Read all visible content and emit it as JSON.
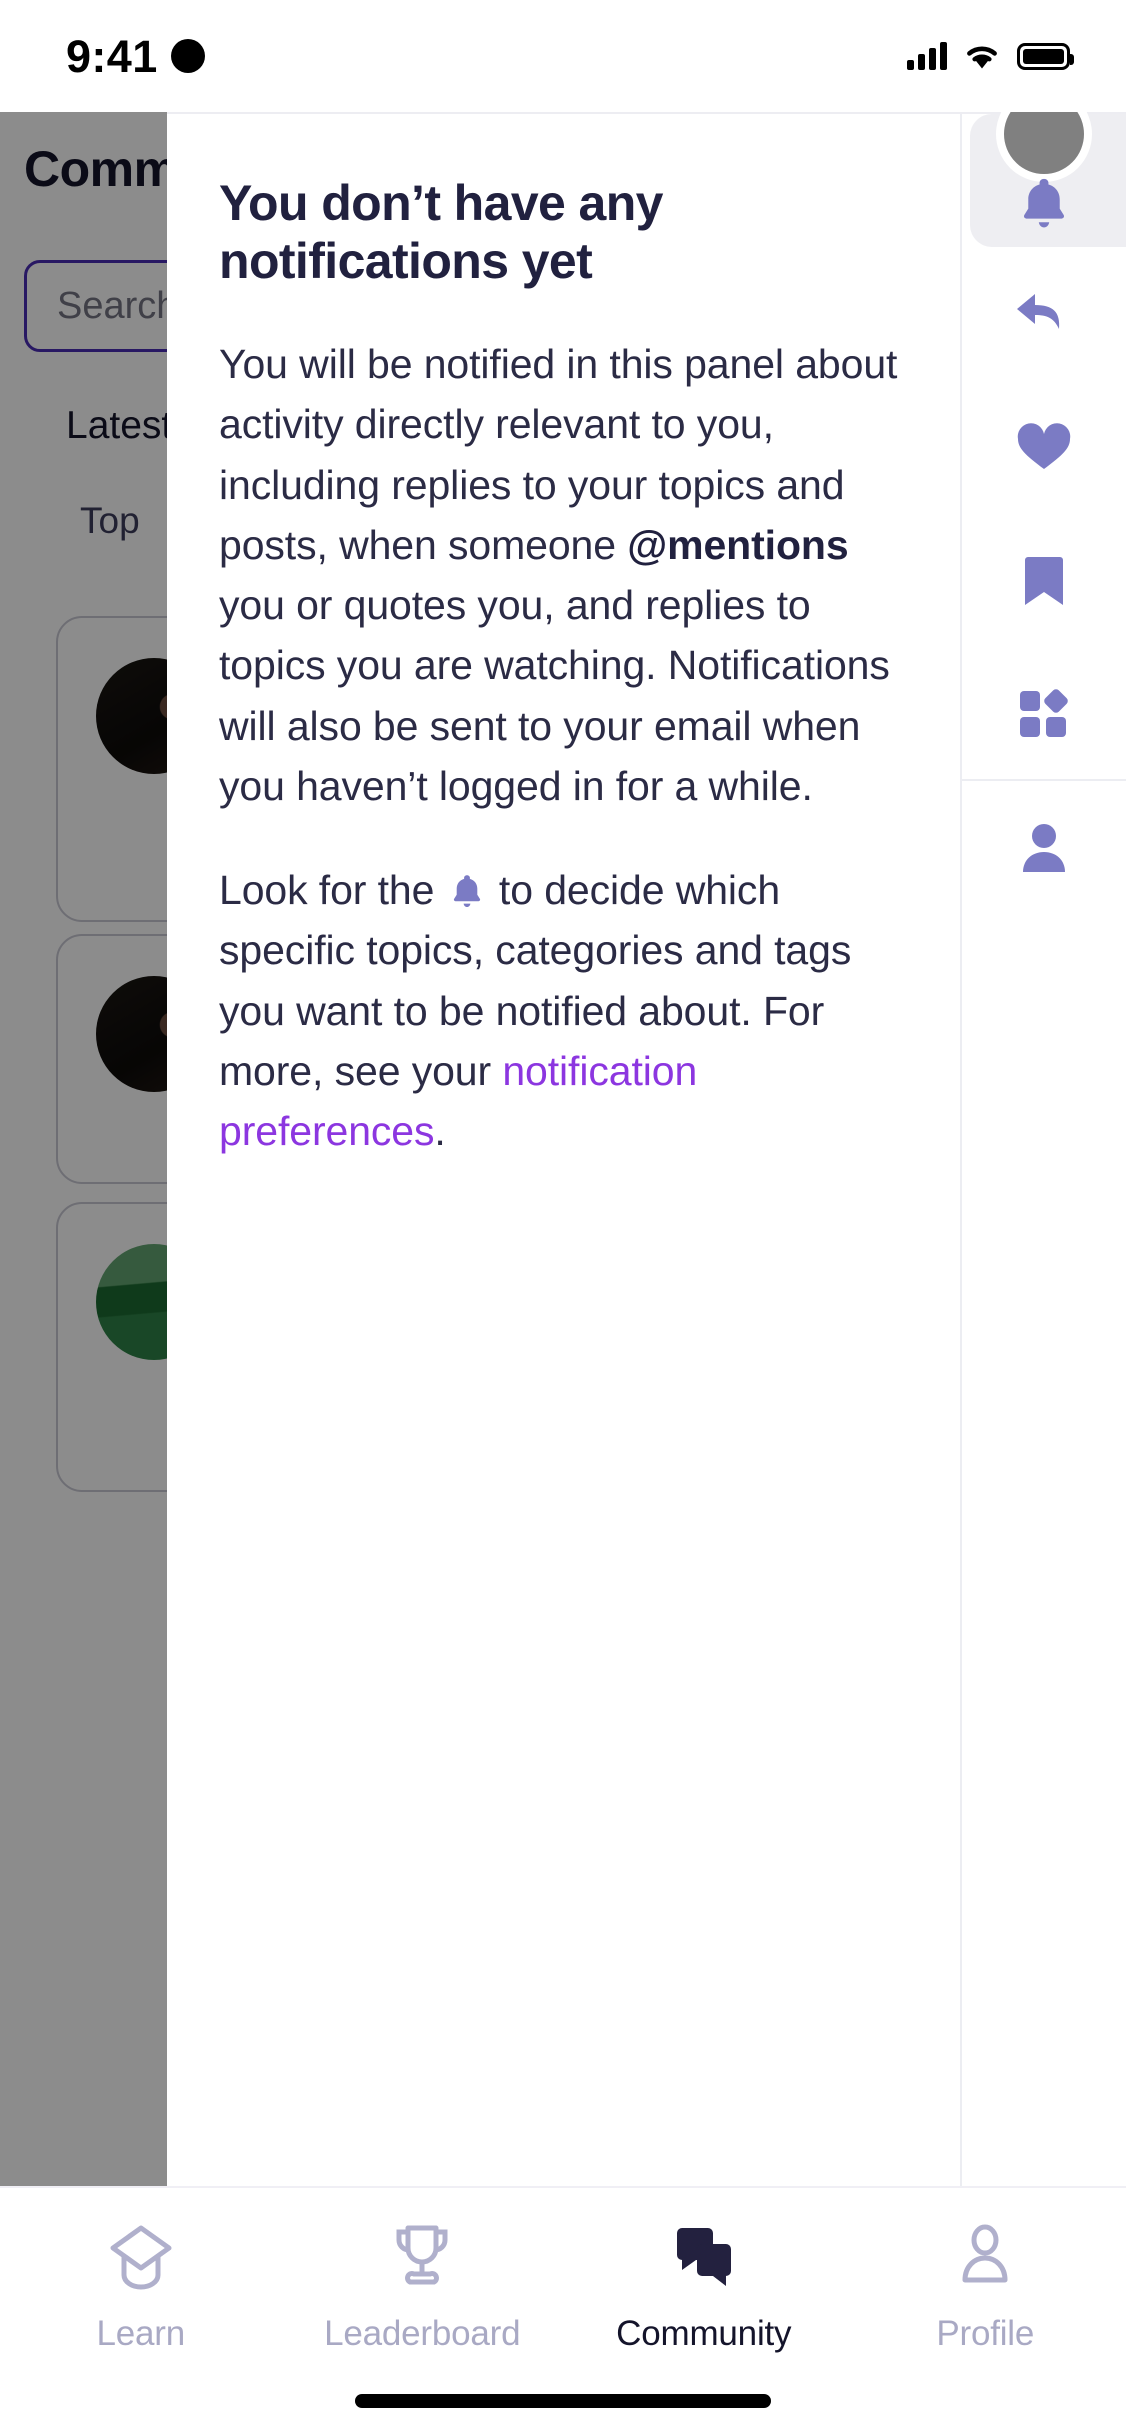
{
  "status_bar": {
    "time": "9:41",
    "icons": [
      "moon-icon",
      "cellular-signal-icon",
      "wifi-icon",
      "battery-icon"
    ]
  },
  "background_app": {
    "title": "Community",
    "search": {
      "placeholder": "Search",
      "value": ""
    },
    "segments": [
      {
        "label": "Latest",
        "active": true
      },
      {
        "label": "Top",
        "active": false
      }
    ],
    "cards": [
      {
        "avatar": "dark-portrait-avatar"
      },
      {
        "avatar": "dark-portrait-avatar"
      },
      {
        "avatar": "green-landscape-avatar"
      }
    ]
  },
  "notification_panel": {
    "title": "You don’t have any notifications yet",
    "paragraph_1_prefix": "You will be notified in this panel about activity directly relevant to you, including replies to your topics and posts, when someone ",
    "paragraph_1_bold": "@mentions",
    "paragraph_1_suffix": " you or quotes you, and replies to topics you are watching. Notifications will also be sent to your email when you haven’t logged in for a while.",
    "paragraph_2_prefix": "Look for the ",
    "paragraph_2_mid": " to decide which specific topics, categories and tags you want to be notified about. For more, see your ",
    "paragraph_2_link": "notification preferences",
    "paragraph_2_suffix": ".",
    "inline_icon": "bell-icon"
  },
  "rail": {
    "items": [
      {
        "icon": "bell-icon",
        "name": "notifications",
        "active": true
      },
      {
        "icon": "reply-arrow-icon",
        "name": "replies",
        "active": false
      },
      {
        "icon": "heart-icon",
        "name": "likes",
        "active": false
      },
      {
        "icon": "bookmark-icon",
        "name": "bookmarks",
        "active": false
      },
      {
        "icon": "grid-apps-icon",
        "name": "other",
        "active": false
      },
      {
        "icon": "person-icon",
        "name": "profile",
        "active": false
      }
    ],
    "avatar": "user-avatar"
  },
  "tab_bar": {
    "tabs": [
      {
        "label": "Learn",
        "icon": "graduation-cap-icon",
        "active": false
      },
      {
        "label": "Leaderboard",
        "icon": "trophy-icon",
        "active": false
      },
      {
        "label": "Community",
        "icon": "chat-bubbles-icon",
        "active": true
      },
      {
        "label": "Profile",
        "icon": "person-outline-icon",
        "active": false
      }
    ]
  },
  "colors": {
    "accent_purple": "#7b7bc4",
    "link_purple": "#8c36e0",
    "heading_navy": "#21213f",
    "tab_inactive": "#a9a9c4",
    "tab_active": "#14142b",
    "search_border": "#4a2db5"
  }
}
